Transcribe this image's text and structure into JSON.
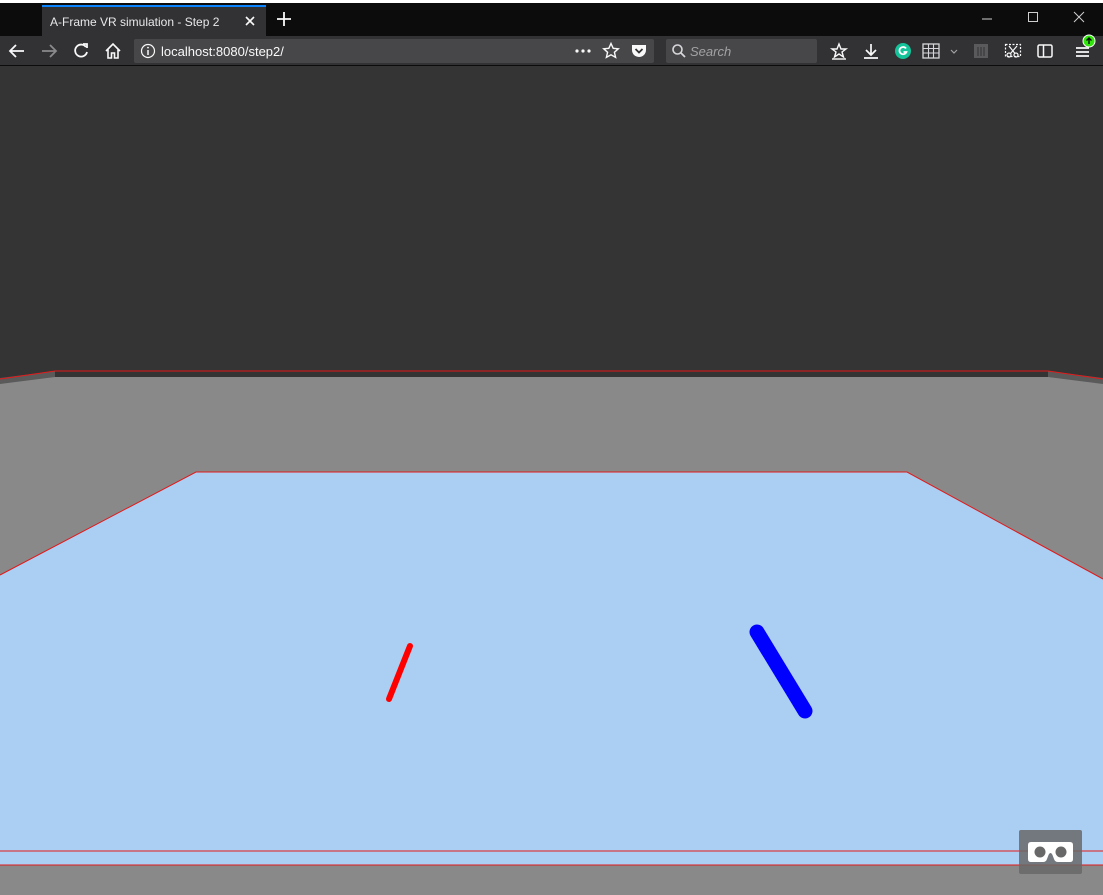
{
  "browser": {
    "tab_title": "A-Frame VR simulation - Step 2",
    "url": "localhost:8080/step2/",
    "search_placeholder": "Search",
    "accent_color": "#0a84ff"
  },
  "icons": {
    "back": "back-arrow-icon",
    "forward": "forward-arrow-icon",
    "reload": "reload-icon",
    "home": "home-icon",
    "info": "info-icon",
    "page_actions": "more-dots-icon",
    "bookmark": "star-icon",
    "pocket": "pocket-icon",
    "search": "search-icon",
    "library": "library-icon",
    "downloads": "download-icon",
    "grammarly": "grammarly-icon",
    "extension": "grid-icon",
    "sidebar": "sidebar-icon",
    "menu": "hamburger-menu-icon",
    "update": "update-badge-icon",
    "vr_mode": "vr-headset-icon"
  },
  "scene": {
    "sky_color": "#343434",
    "floor_color": "#898989",
    "platform_color": "#aacff2",
    "outline_color": "#e41919",
    "left_controller_color": "#ff0000",
    "right_controller_color": "#0000ff"
  }
}
